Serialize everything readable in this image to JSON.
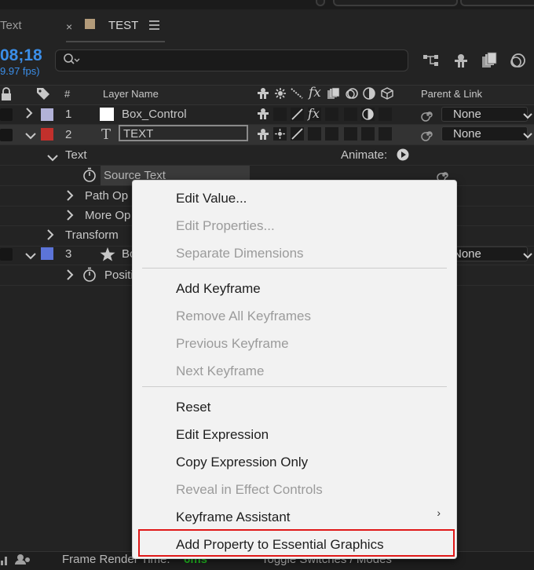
{
  "tabs": {
    "previous_tab_label": "Text",
    "close_glyph": "×",
    "active_tab_label": "TEST"
  },
  "timecode": {
    "value": "08;18",
    "fps": "9.97 fps)"
  },
  "search": {
    "icon": "search-icon",
    "value": ""
  },
  "columns": {
    "index": "#",
    "layer_name": "Layer Name",
    "parent_link": "Parent & Link"
  },
  "layers": [
    {
      "number": "1",
      "name": "Box_Control",
      "label_color": "#b2b2d8",
      "parent": "None"
    },
    {
      "number": "2",
      "name": "TEXT",
      "label_color": "#c2302c",
      "parent": "None"
    },
    {
      "number": "3",
      "name": "Bo",
      "label_color": "#5c74d8",
      "parent": "None"
    }
  ],
  "properties": {
    "text_group": "Text",
    "animate_label": "Animate:",
    "source_text": "Source Text",
    "path_options": "Path Op",
    "more_options": "More Op",
    "transform": "Transform",
    "position": "Positi"
  },
  "context_menu": {
    "items": [
      {
        "label": "Edit Value...",
        "enabled": true
      },
      {
        "label": "Edit Properties...",
        "enabled": false
      },
      {
        "label": "Separate Dimensions",
        "enabled": false
      },
      {
        "label": "Add Keyframe",
        "enabled": true
      },
      {
        "label": "Remove All Keyframes",
        "enabled": false
      },
      {
        "label": "Previous Keyframe",
        "enabled": false
      },
      {
        "label": "Next Keyframe",
        "enabled": false
      },
      {
        "label": "Reset",
        "enabled": true
      },
      {
        "label": "Edit Expression",
        "enabled": true
      },
      {
        "label": "Copy Expression Only",
        "enabled": true
      },
      {
        "label": "Reveal in Effect Controls",
        "enabled": false
      },
      {
        "label": "Keyframe Assistant",
        "enabled": true,
        "submenu": true
      },
      {
        "label": "Add Property to Essential Graphics",
        "enabled": true,
        "highlighted": true
      }
    ],
    "submenu_glyph": "›"
  },
  "footer": {
    "frame_render_label": "Frame Render Time:",
    "frame_render_value": "6ms",
    "toggle_label": "Toggle Switches / Modes"
  },
  "colors": {
    "accent_blue": "#3b8ee8",
    "highlight_red": "#e01818",
    "menu_bg": "#f2f2f2",
    "render_green": "#23c423"
  }
}
